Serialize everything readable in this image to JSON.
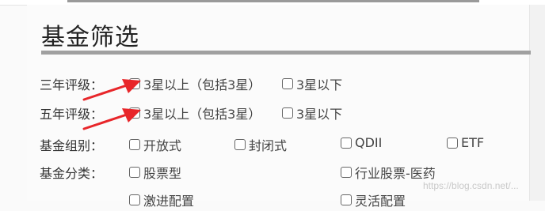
{
  "title": "基金筛选",
  "rows": [
    {
      "label": "三年评级：",
      "options": [
        "3星以上（包括3星）",
        "3星以下"
      ]
    },
    {
      "label": "五年评级：",
      "options": [
        "3星以上（包括3星）",
        "3星以下"
      ]
    },
    {
      "label": "基金组别：",
      "options": [
        "开放式",
        "封闭式",
        "QDII",
        "ETF"
      ]
    },
    {
      "label": "基金分类：",
      "options": [
        "股票型",
        "行业股票-医药"
      ]
    },
    {
      "label": "",
      "options": [
        "激进配置",
        "灵活配置"
      ]
    }
  ],
  "watermark": "https://blog.csdn.net/...",
  "colors": {
    "arrow": "#e8262a",
    "title_rule": "#a0a0a0"
  }
}
